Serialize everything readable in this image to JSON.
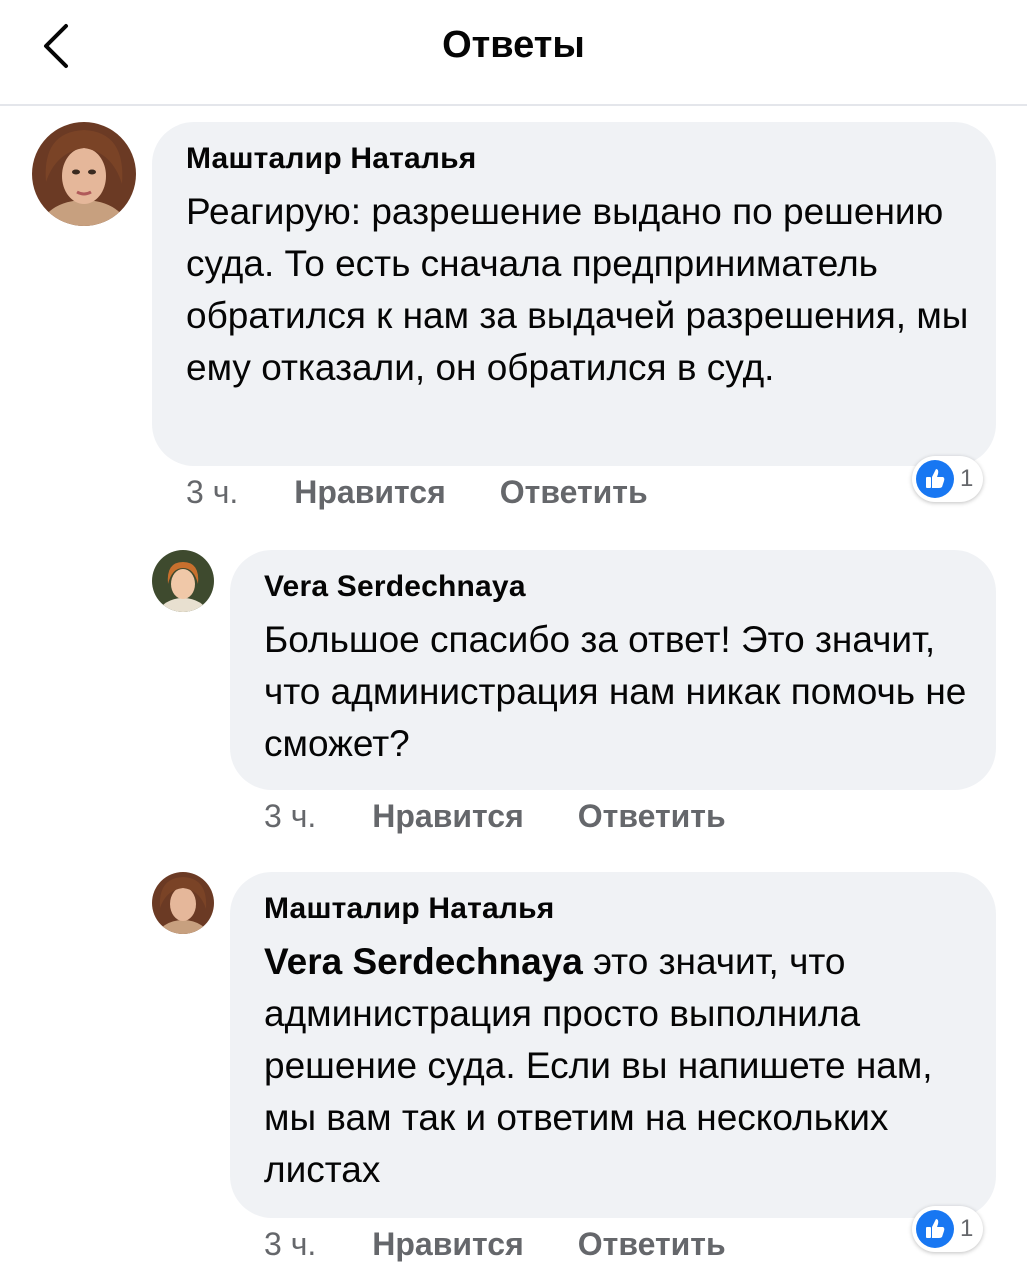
{
  "header": {
    "title": "Ответы"
  },
  "comments": [
    {
      "author": "Машталир Наталья",
      "text": "Реагирую: разрешение выдано по решению суда. То есть сначала предприниматель обратился к нам за выдачей разрешения, мы ему отказали, он обратился в суд.",
      "time": "3 ч.",
      "like_label": "Нравится",
      "reply_label": "Ответить",
      "reaction_count": "1"
    },
    {
      "author": "Vera Serdechnaya",
      "text": "Большое спасибо за ответ! Это значит, что администрация нам никак помочь не сможет?",
      "time": "3 ч.",
      "like_label": "Нравится",
      "reply_label": "Ответить"
    },
    {
      "author": "Машталир Наталья",
      "mention": "Vera Serdechnaya",
      "text": " это значит, что администрация просто выполнила решение суда. Если вы напишете нам, мы вам так и ответим на нескольких листах",
      "time": "3 ч.",
      "like_label": "Нравится",
      "reply_label": "Ответить",
      "reaction_count": "1"
    }
  ],
  "colors": {
    "bubble": "#f0f2f5",
    "meta": "#65676b",
    "like_blue": "#1877f2"
  }
}
